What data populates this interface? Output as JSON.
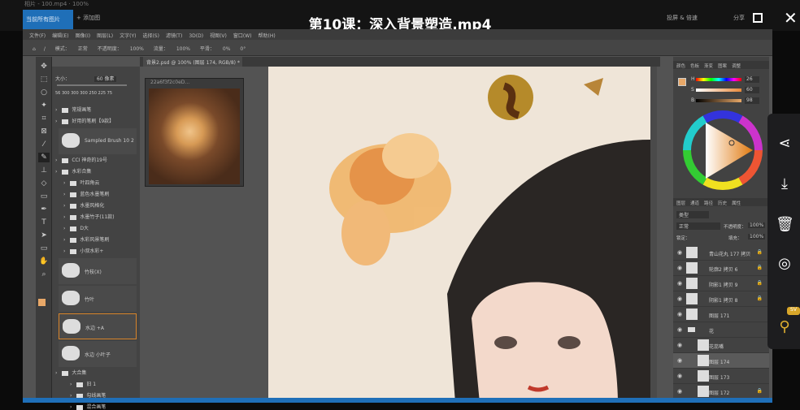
{
  "player": {
    "window_title": "相片 - 100.mp4 · 100%",
    "active_tab": "当前所有图片",
    "add_tab": "+ 添加图",
    "video_title": "第10课：深入背景塑造.mp4",
    "cast_label": "投屏 & 倍速",
    "share_label": "分享",
    "accent": "#1f6fb8"
  },
  "ps": {
    "menu": [
      "文件(F)",
      "编辑(E)",
      "图像(I)",
      "图层(L)",
      "文字(Y)",
      "选择(S)",
      "滤镜(T)",
      "3D(D)",
      "视图(V)",
      "窗口(W)",
      "帮助(H)"
    ],
    "options": {
      "mode_label": "模式：",
      "mode_value": "正常",
      "opacity_label": "不透明度：",
      "opacity": "100%",
      "flow_label": "流量：",
      "flow": "100%",
      "smooth_label": "平滑：",
      "smooth": "0%",
      "angle": "0°"
    },
    "doc_tab": "背景2.psd @ 100% (图层 174, RGB/8) *",
    "ref_window_title": "22a6f3f2c0eD...",
    "brush": {
      "size_label": "大小：",
      "size": "60 像素",
      "presets": [
        "56",
        "300",
        "300",
        "300",
        "250",
        "225",
        "75"
      ],
      "items": [
        {
          "type": "folder",
          "label": "常规画笔"
        },
        {
          "type": "folder",
          "label": "好用的笔刷【9款】"
        },
        {
          "type": "brush",
          "label": "Sampled Brush 10 2"
        },
        {
          "type": "folder",
          "label": "CCI 神奇的19号"
        },
        {
          "type": "folder",
          "label": "水彩合集"
        },
        {
          "type": "folder",
          "label": "叶四角云"
        },
        {
          "type": "folder",
          "label": "蓝色水墨笔刷"
        },
        {
          "type": "folder",
          "label": "水墨风格化"
        },
        {
          "type": "folder",
          "label": "水墨竹子(11款)"
        },
        {
          "type": "folder",
          "label": "D大"
        },
        {
          "type": "folder",
          "label": "水彩风景笔刷"
        },
        {
          "type": "folder",
          "label": "小叔水彩+"
        },
        {
          "type": "brush",
          "label": "竹枝(X)"
        },
        {
          "type": "brush",
          "label": "竹叶"
        },
        {
          "type": "brush",
          "label": "水边 +A",
          "selected": true
        },
        {
          "type": "brush",
          "label": "水边 小叶子"
        },
        {
          "type": "folder",
          "label": "大合集"
        },
        {
          "type": "folder",
          "label": "旧 1"
        },
        {
          "type": "folder",
          "label": "勾线画笔"
        },
        {
          "type": "folder",
          "label": "混合画笔"
        }
      ]
    },
    "color": {
      "tabs": [
        "颜色",
        "色板",
        "渐变",
        "图案",
        "调整",
        "学习"
      ],
      "H": "26",
      "S": "60",
      "B": "98",
      "unit": "%",
      "foreground": "#e8a868",
      "background": "#c9b79e"
    },
    "layers": {
      "tabs": [
        "图层",
        "通道",
        "路径",
        "历史",
        "属性"
      ],
      "filter": "类型",
      "blend": "正常",
      "opacity_label": "不透明度：",
      "opacity": "100%",
      "lock_label": "锁定：",
      "fill_label": "填充：",
      "fill": "100%",
      "items": [
        {
          "name": "青山花丸 177 拷贝",
          "locked": true
        },
        {
          "name": "轮廓2 拷贝 6",
          "locked": true
        },
        {
          "name": "阴影1 拷贝 9",
          "locked": true
        },
        {
          "name": "阴影1 拷贝 8",
          "locked": true
        },
        {
          "name": "图层 171"
        },
        {
          "name": "花",
          "group": true
        },
        {
          "name": "花蕊嘴"
        },
        {
          "name": "图层 174",
          "selected": true
        },
        {
          "name": "图层 173"
        },
        {
          "name": "图层 172",
          "locked": true
        }
      ]
    }
  },
  "dock": {
    "icons": [
      "share-icon",
      "download-icon",
      "trash-icon",
      "target-icon",
      "pin-icon"
    ],
    "badge": "SV"
  }
}
